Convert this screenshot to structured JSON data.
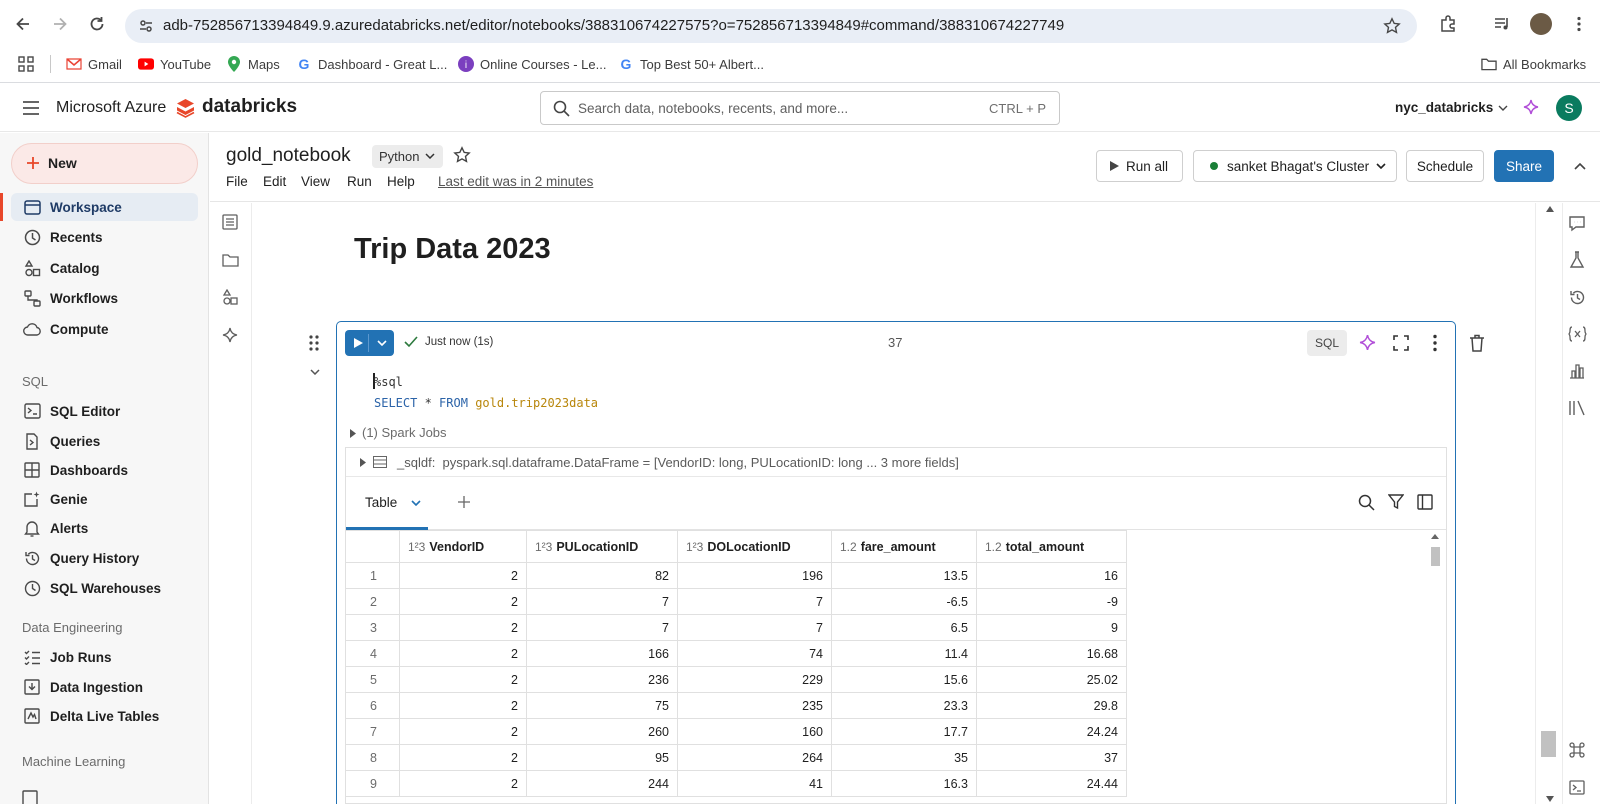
{
  "browser": {
    "url": "adb-752856713394849.9.azuredatabricks.net/editor/notebooks/388310674227575?o=752856713394849#command/388310674227749",
    "profile_initial": "S",
    "bookmarks": [
      "Gmail",
      "YouTube",
      "Maps",
      "Dashboard - Great L...",
      "Online Courses - Le...",
      "Top Best 50+ Albert..."
    ],
    "all_bookmarks": "All Bookmarks"
  },
  "topbar": {
    "brand": "Microsoft Azure",
    "product": "databricks",
    "search_placeholder": "Search data, notebooks, recents, and more...",
    "search_shortcut": "CTRL + P",
    "workspace": "nyc_databricks",
    "user_initial": "S"
  },
  "sidebar": {
    "new_label": "New",
    "items": [
      "Workspace",
      "Recents",
      "Catalog",
      "Workflows",
      "Compute"
    ],
    "sql_section": "SQL",
    "sql_items": [
      "SQL Editor",
      "Queries",
      "Dashboards",
      "Genie",
      "Alerts",
      "Query History",
      "SQL Warehouses"
    ],
    "de_section": "Data Engineering",
    "de_items": [
      "Job Runs",
      "Data Ingestion",
      "Delta Live Tables"
    ],
    "ml_section": "Machine Learning"
  },
  "notebook": {
    "title": "gold_notebook",
    "language": "Python",
    "menus": [
      "File",
      "Edit",
      "View",
      "Run",
      "Help"
    ],
    "last_edit": "Last edit was in 2 minutes",
    "run_all": "Run all",
    "cluster": "sanket Bhagat's Cluster",
    "schedule": "Schedule",
    "share": "Share",
    "markdown_title": "Trip Data 2023"
  },
  "cell": {
    "status": "Just now (1s)",
    "number": "37",
    "lang_badge": "SQL",
    "code_line1": "%sql",
    "code_kw1": "SELECT",
    "code_star": " * ",
    "code_kw2": "FROM",
    "code_schema": "gold",
    "code_table": ".trip2023data",
    "spark_jobs": "(1) Spark Jobs",
    "df_name": "_sqldf:",
    "df_type": "pyspark.sql.dataframe.DataFrame = [VendorID: long, PULocationID: long ... 3 more fields]",
    "tab_label": "Table"
  },
  "table": {
    "columns": [
      {
        "type": "1²3",
        "name": "VendorID"
      },
      {
        "type": "1²3",
        "name": "PULocationID"
      },
      {
        "type": "1²3",
        "name": "DOLocationID"
      },
      {
        "type": "1.2",
        "name": "fare_amount"
      },
      {
        "type": "1.2",
        "name": "total_amount"
      }
    ],
    "rows": [
      [
        "1",
        "2",
        "82",
        "196",
        "13.5",
        "16"
      ],
      [
        "2",
        "2",
        "7",
        "7",
        "-6.5",
        "-9"
      ],
      [
        "3",
        "2",
        "7",
        "7",
        "6.5",
        "9"
      ],
      [
        "4",
        "2",
        "166",
        "74",
        "11.4",
        "16.68"
      ],
      [
        "5",
        "2",
        "236",
        "229",
        "15.6",
        "25.02"
      ],
      [
        "6",
        "2",
        "75",
        "235",
        "23.3",
        "29.8"
      ],
      [
        "7",
        "2",
        "260",
        "160",
        "17.7",
        "24.24"
      ],
      [
        "8",
        "2",
        "95",
        "264",
        "35",
        "37"
      ],
      [
        "9",
        "2",
        "244",
        "41",
        "16.3",
        "24.44"
      ]
    ]
  },
  "colors": {
    "accent": "#2272b4",
    "brand_red": "#e8472a",
    "new_bg": "#fbe9e7",
    "cluster_dot": "#1a7f37"
  }
}
